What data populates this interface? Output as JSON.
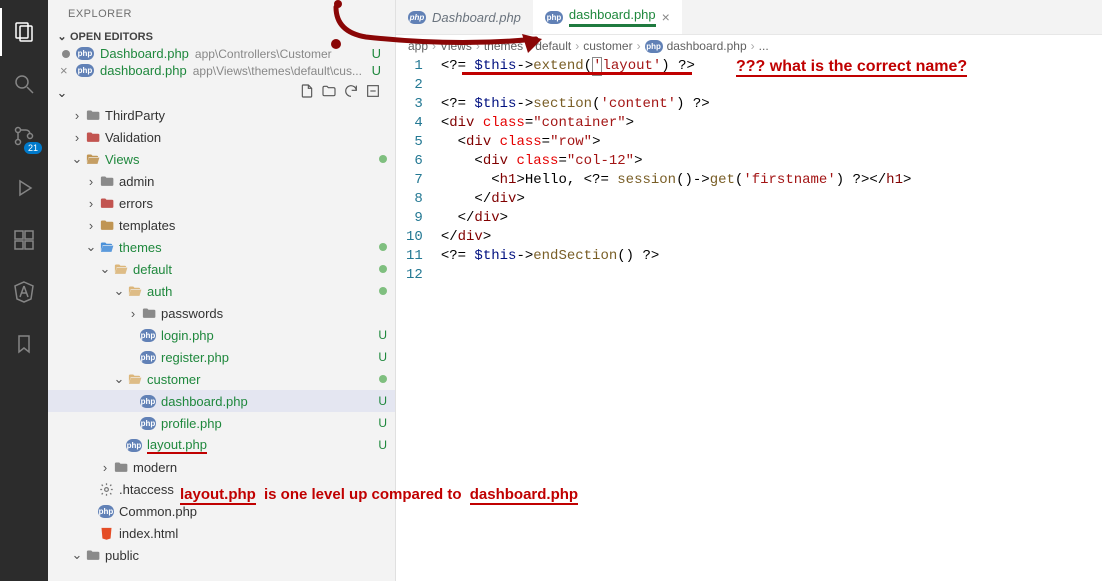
{
  "sidebar": {
    "title": "EXPLORER",
    "openEditorsLabel": "OPEN EDITORS",
    "openEditors": [
      {
        "name": "Dashboard.php",
        "path": "app\\Controllers\\Customer",
        "git": "U",
        "dirty": true
      },
      {
        "name": "dashboard.php",
        "path": "app\\Views\\themes\\default\\cus...",
        "git": "U",
        "dirty": false
      }
    ],
    "toolbar": {
      "newFile": "new-file",
      "newFolder": "new-folder",
      "refresh": "refresh",
      "collapse": "collapse"
    },
    "tree": [
      {
        "depth": 1,
        "type": "folder",
        "style": "grey",
        "expand": "closed",
        "label": "ThirdParty"
      },
      {
        "depth": 1,
        "type": "folder",
        "style": "red",
        "expand": "closed",
        "label": "Validation"
      },
      {
        "depth": 1,
        "type": "folder",
        "style": "tan-open",
        "expand": "open",
        "label": "Views",
        "mod": true,
        "moddot": true
      },
      {
        "depth": 2,
        "type": "folder",
        "style": "grey",
        "expand": "closed",
        "label": "admin"
      },
      {
        "depth": 2,
        "type": "folder",
        "style": "red",
        "expand": "closed",
        "label": "errors"
      },
      {
        "depth": 2,
        "type": "folder",
        "style": "tan",
        "expand": "closed",
        "label": "templates"
      },
      {
        "depth": 2,
        "type": "folder",
        "style": "blue-open",
        "expand": "open",
        "label": "themes",
        "mod": true,
        "moddot": true
      },
      {
        "depth": 3,
        "type": "folder",
        "style": "open",
        "expand": "open",
        "label": "default",
        "mod": true,
        "moddot": true
      },
      {
        "depth": 4,
        "type": "folder",
        "style": "open",
        "expand": "open",
        "label": "auth",
        "mod": true,
        "moddot": true
      },
      {
        "depth": 5,
        "type": "folder",
        "style": "grey",
        "expand": "closed",
        "label": "passwords"
      },
      {
        "depth": 5,
        "type": "php",
        "label": "login.php",
        "mod": true,
        "git": "U"
      },
      {
        "depth": 5,
        "type": "php",
        "label": "register.php",
        "mod": true,
        "git": "U"
      },
      {
        "depth": 4,
        "type": "folder",
        "style": "open",
        "expand": "open",
        "label": "customer",
        "mod": true,
        "moddot": true
      },
      {
        "depth": 5,
        "type": "php",
        "label": "dashboard.php",
        "mod": true,
        "git": "U",
        "selected": true
      },
      {
        "depth": 5,
        "type": "php",
        "label": "profile.php",
        "mod": true,
        "git": "U"
      },
      {
        "depth": 4,
        "type": "php",
        "label": "layout.php",
        "mod": true,
        "git": "U",
        "underline": true
      },
      {
        "depth": 3,
        "type": "folder",
        "style": "grey",
        "expand": "closed",
        "label": "modern"
      },
      {
        "depth": 2,
        "type": "cfg",
        "label": ".htaccess"
      },
      {
        "depth": 2,
        "type": "php",
        "label": "Common.php"
      },
      {
        "depth": 2,
        "type": "html",
        "label": "index.html"
      },
      {
        "depth": 1,
        "type": "folder",
        "style": "grey",
        "expand": "open",
        "label": "public"
      }
    ]
  },
  "tabs": [
    {
      "label": "Dashboard.php",
      "active": false
    },
    {
      "label": "dashboard.php",
      "active": true
    }
  ],
  "breadcrumb": [
    "app",
    "Views",
    "themes",
    "default",
    "customer",
    "dashboard.php",
    "..."
  ],
  "code": {
    "lines": [
      [
        {
          "t": "<?= ",
          "c": "tk-php"
        },
        {
          "t": "$this",
          "c": "tk-var"
        },
        {
          "t": "->",
          "c": "tk-punc"
        },
        {
          "t": "extend",
          "c": "tk-fn"
        },
        {
          "t": "(",
          "c": "tk-punc"
        },
        {
          "t": "'",
          "c": "tk-str cursor-box"
        },
        {
          "t": "layout'",
          "c": "tk-str"
        },
        {
          "t": ")",
          "c": "tk-punc"
        },
        {
          "t": " ?>",
          "c": "tk-php"
        }
      ],
      [],
      [
        {
          "t": "<?= ",
          "c": "tk-php"
        },
        {
          "t": "$this",
          "c": "tk-var"
        },
        {
          "t": "->",
          "c": "tk-punc"
        },
        {
          "t": "section",
          "c": "tk-fn"
        },
        {
          "t": "(",
          "c": "tk-punc"
        },
        {
          "t": "'content'",
          "c": "tk-str"
        },
        {
          "t": ") ",
          "c": "tk-punc"
        },
        {
          "t": "?>",
          "c": "tk-php"
        }
      ],
      [
        {
          "t": "<",
          "c": "tk-punc"
        },
        {
          "t": "div ",
          "c": "tk-tag"
        },
        {
          "t": "class",
          "c": "tk-attr"
        },
        {
          "t": "=",
          "c": "tk-punc"
        },
        {
          "t": "\"container\"",
          "c": "tk-str"
        },
        {
          "t": ">",
          "c": "tk-punc"
        }
      ],
      [
        {
          "t": "  <",
          "c": "tk-punc"
        },
        {
          "t": "div ",
          "c": "tk-tag"
        },
        {
          "t": "class",
          "c": "tk-attr"
        },
        {
          "t": "=",
          "c": "tk-punc"
        },
        {
          "t": "\"row\"",
          "c": "tk-str"
        },
        {
          "t": ">",
          "c": "tk-punc"
        }
      ],
      [
        {
          "t": "    <",
          "c": "tk-punc"
        },
        {
          "t": "div ",
          "c": "tk-tag"
        },
        {
          "t": "class",
          "c": "tk-attr"
        },
        {
          "t": "=",
          "c": "tk-punc"
        },
        {
          "t": "\"col-12\"",
          "c": "tk-str"
        },
        {
          "t": ">",
          "c": "tk-punc"
        }
      ],
      [
        {
          "t": "      <",
          "c": "tk-punc"
        },
        {
          "t": "h1",
          "c": "tk-tag"
        },
        {
          "t": ">",
          "c": "tk-punc"
        },
        {
          "t": "Hello, ",
          "c": "tk-punc"
        },
        {
          "t": "<?= ",
          "c": "tk-php"
        },
        {
          "t": "session",
          "c": "tk-fn"
        },
        {
          "t": "()->",
          "c": "tk-punc"
        },
        {
          "t": "get",
          "c": "tk-fn"
        },
        {
          "t": "(",
          "c": "tk-punc"
        },
        {
          "t": "'firstname'",
          "c": "tk-str"
        },
        {
          "t": ") ",
          "c": "tk-punc"
        },
        {
          "t": "?>",
          "c": "tk-php"
        },
        {
          "t": "</",
          "c": "tk-punc"
        },
        {
          "t": "h1",
          "c": "tk-tag"
        },
        {
          "t": ">",
          "c": "tk-punc"
        }
      ],
      [
        {
          "t": "    </",
          "c": "tk-punc"
        },
        {
          "t": "div",
          "c": "tk-tag"
        },
        {
          "t": ">",
          "c": "tk-punc"
        }
      ],
      [
        {
          "t": "  </",
          "c": "tk-punc"
        },
        {
          "t": "div",
          "c": "tk-tag"
        },
        {
          "t": ">",
          "c": "tk-punc"
        }
      ],
      [
        {
          "t": "</",
          "c": "tk-punc"
        },
        {
          "t": "div",
          "c": "tk-tag"
        },
        {
          "t": ">",
          "c": "tk-punc"
        }
      ],
      [
        {
          "t": "<?= ",
          "c": "tk-php"
        },
        {
          "t": "$this",
          "c": "tk-var"
        },
        {
          "t": "->",
          "c": "tk-punc"
        },
        {
          "t": "endSection",
          "c": "tk-fn"
        },
        {
          "t": "() ",
          "c": "tk-punc"
        },
        {
          "t": "?>",
          "c": "tk-php"
        }
      ],
      []
    ]
  },
  "annotations": {
    "question": "??? what is the correct name?",
    "note": "is one level up compared to",
    "layoutWord": "layout.php",
    "dashWord": "dashboard.php"
  },
  "activity": {
    "scmBadge": "21"
  }
}
